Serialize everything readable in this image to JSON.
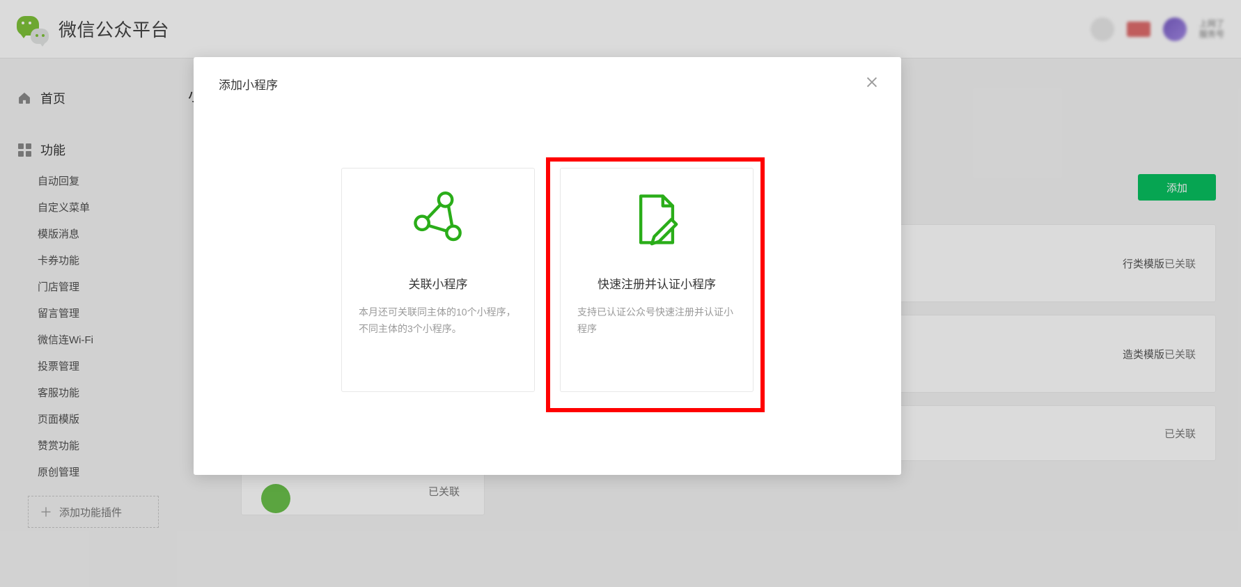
{
  "header": {
    "platform_title": "微信公众平台",
    "account_name": "上网了",
    "account_sub": "服务号"
  },
  "sidebar": {
    "home_label": "首页",
    "features_label": "功能",
    "items": [
      {
        "label": "自动回复"
      },
      {
        "label": "自定义菜单"
      },
      {
        "label": "模版消息"
      },
      {
        "label": "卡券功能"
      },
      {
        "label": "门店管理"
      },
      {
        "label": "留言管理"
      },
      {
        "label": "微信连Wi-Fi"
      },
      {
        "label": "投票管理"
      },
      {
        "label": "客服功能"
      },
      {
        "label": "页面模版"
      },
      {
        "label": "赞赏功能"
      },
      {
        "label": "原创管理"
      }
    ],
    "add_plugin_label": "添加功能插件"
  },
  "content": {
    "page_title_prefix": "小",
    "add_button_label": "添加",
    "cards": [
      {
        "desc": "行类模版",
        "status": "已关联"
      },
      {
        "desc": "造类模版",
        "status": "已关联"
      },
      {
        "desc": "",
        "status": "已关联"
      }
    ],
    "bottom_card_status": "已关联"
  },
  "modal": {
    "title": "添加小程序",
    "options": [
      {
        "title": "关联小程序",
        "desc": "本月还可关联同主体的10个小程序，不同主体的3个小程序。"
      },
      {
        "title": "快速注册并认证小程序",
        "desc": "支持已认证公众号快速注册并认证小程序"
      }
    ]
  },
  "colors": {
    "brand_green": "#07c160",
    "icon_green": "#2aad19",
    "highlight_red": "#ff0000"
  }
}
